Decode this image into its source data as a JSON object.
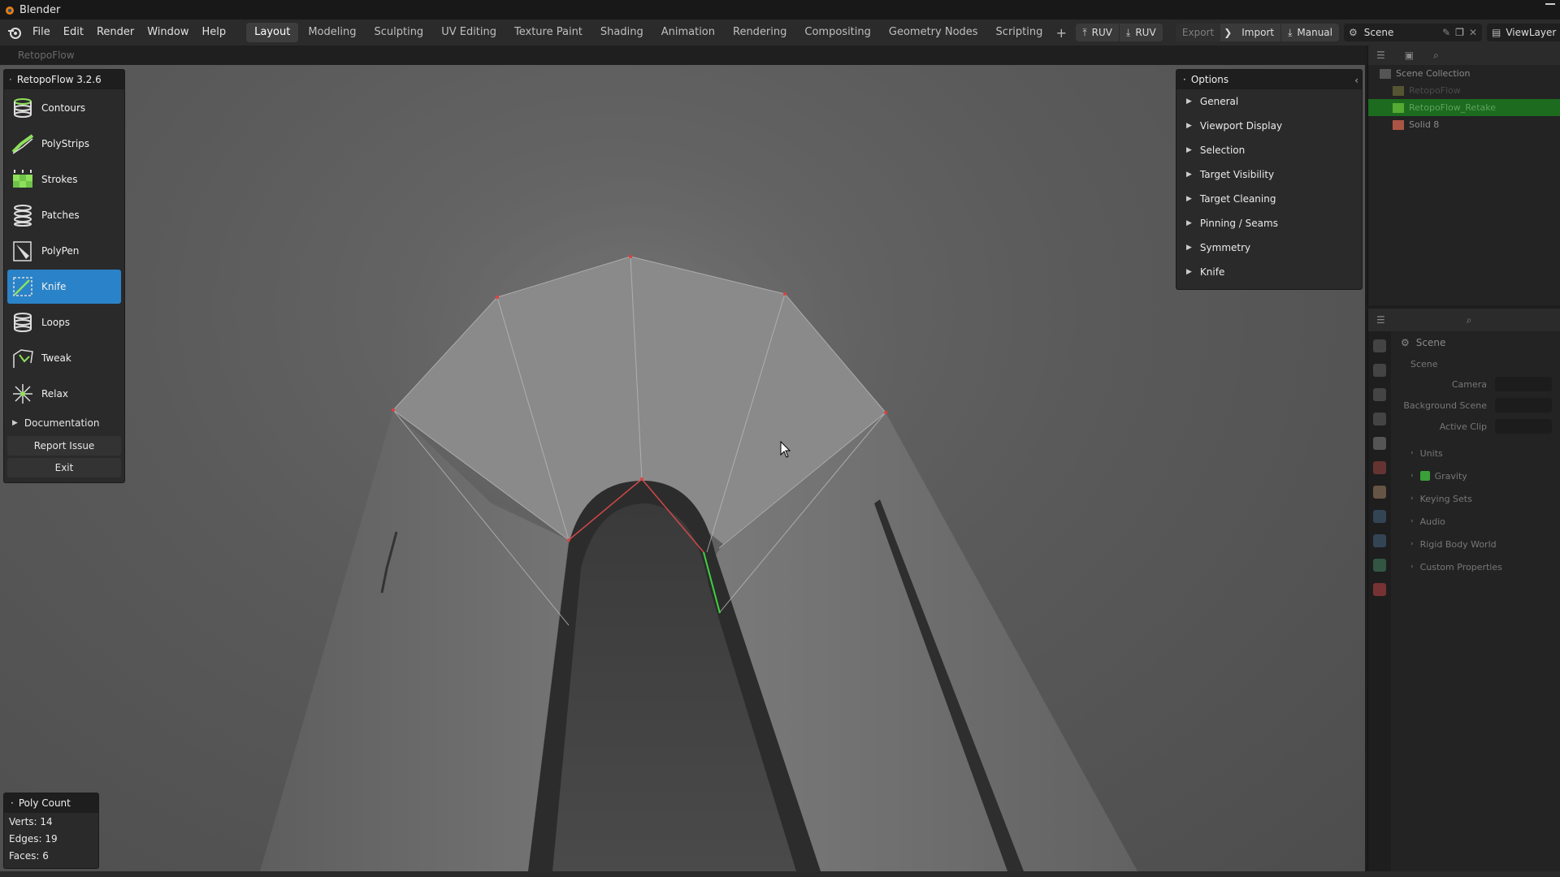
{
  "window": {
    "title": "Blender"
  },
  "menu": [
    "File",
    "Edit",
    "Render",
    "Window",
    "Help"
  ],
  "workspaces": [
    "Layout",
    "Modeling",
    "Sculpting",
    "UV Editing",
    "Texture Paint",
    "Shading",
    "Animation",
    "Rendering",
    "Compositing",
    "Geometry Nodes",
    "Scripting"
  ],
  "active_workspace": "Layout",
  "ruv_buttons": [
    "RUV",
    "RUV"
  ],
  "toolbar_right": {
    "export": "Export",
    "import": "Import",
    "manual": "Manual",
    "scene": "Scene",
    "view_layer": "ViewLayer"
  },
  "header_label": "RetopoFlow",
  "retopoflow": {
    "title": "RetopoFlow 3.2.6",
    "tools": [
      {
        "label": "Contours",
        "icon": "contours-icon"
      },
      {
        "label": "PolyStrips",
        "icon": "polystrips-icon"
      },
      {
        "label": "Strokes",
        "icon": "strokes-icon"
      },
      {
        "label": "Patches",
        "icon": "patches-icon"
      },
      {
        "label": "PolyPen",
        "icon": "polypen-icon"
      },
      {
        "label": "Knife",
        "icon": "knife-icon"
      },
      {
        "label": "Loops",
        "icon": "loops-icon"
      },
      {
        "label": "Tweak",
        "icon": "tweak-icon"
      },
      {
        "label": "Relax",
        "icon": "relax-icon"
      }
    ],
    "active_tool": "Knife",
    "documentation": "Documentation",
    "report_issue": "Report Issue",
    "exit": "Exit"
  },
  "options": {
    "title": "Options",
    "items": [
      "General",
      "Viewport Display",
      "Selection",
      "Target Visibility",
      "Target Cleaning",
      "Pinning / Seams",
      "Symmetry",
      "Knife"
    ]
  },
  "poly_count": {
    "title": "Poly Count",
    "verts_label": "Verts:",
    "verts": "14",
    "edges_label": "Edges:",
    "edges": "19",
    "faces_label": "Faces:",
    "faces": "6"
  },
  "outliner": {
    "items": [
      "Scene Collection",
      "RetopoFlow",
      "RetopoFlow_Retake",
      "Solid 8"
    ]
  },
  "properties": {
    "title": "Scene",
    "sub": "Scene",
    "fields": [
      "Camera",
      "Background Scene",
      "Active Clip"
    ],
    "sections": [
      "Units",
      "Gravity",
      "Keying Sets",
      "Audio",
      "Rigid Body World",
      "Custom Properties"
    ]
  },
  "colors": {
    "accent": "#2a83c8",
    "outliner_selected": "#1c6b1f",
    "edge_green": "#3fd13f",
    "vert_red": "#e04040"
  }
}
